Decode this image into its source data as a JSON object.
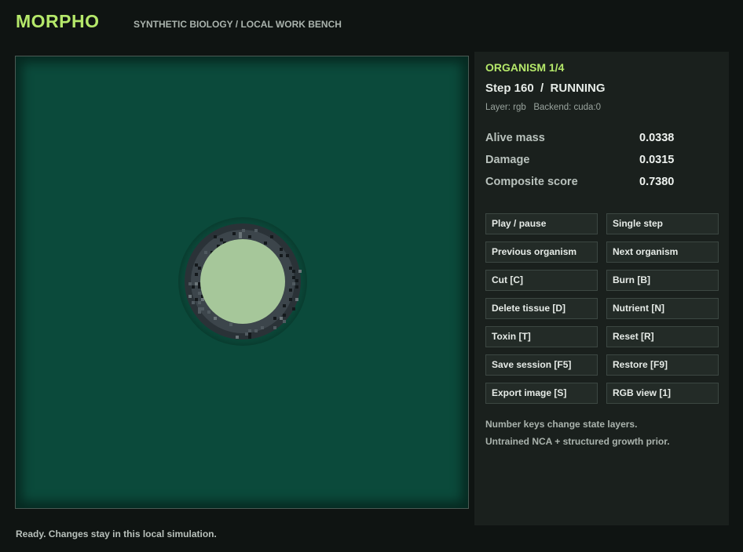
{
  "header": {
    "brand": "MORPHO",
    "subtitle": "SYNTHETIC BIOLOGY / LOCAL WORK BENCH"
  },
  "panel": {
    "organism_title": "ORGANISM 1/4",
    "step_line": "Step 160  /  RUNNING",
    "meta_line": "Layer: rgb   Backend: cuda:0",
    "metrics": [
      {
        "label": "Alive mass",
        "value": "0.0338"
      },
      {
        "label": "Damage",
        "value": "0.0315"
      },
      {
        "label": "Composite score",
        "value": "0.7380"
      }
    ],
    "buttons": [
      "Play / pause",
      "Single step",
      "Previous organism",
      "Next organism",
      "Cut [C]",
      "Burn [B]",
      "Delete tissue [D]",
      "Nutrient [N]",
      "Toxin [T]",
      "Reset [R]",
      "Save session [F5]",
      "Restore [F9]",
      "Export image [S]",
      "RGB view [1]"
    ],
    "notes": [
      "Number keys change state layers.",
      "Untrained NCA + structured growth prior."
    ]
  },
  "status": "Ready. Changes stay in this local simulation.",
  "colors": {
    "accent": "#b5e86a",
    "canvas_bg": "#0b4a3b",
    "organism_core": "#a6c79a",
    "organism_ring": "#2b3338"
  }
}
